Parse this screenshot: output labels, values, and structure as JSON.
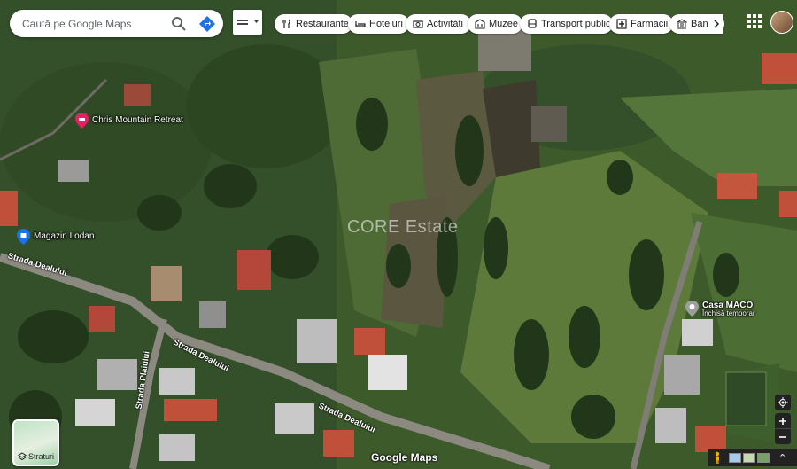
{
  "search": {
    "placeholder": "Caută pe Google Maps"
  },
  "chips": [
    {
      "label": "Restaurante",
      "icon": "fork-knife-icon"
    },
    {
      "label": "Hoteluri",
      "icon": "bed-icon"
    },
    {
      "label": "Activități",
      "icon": "camera-icon"
    },
    {
      "label": "Muzee",
      "icon": "museum-icon"
    },
    {
      "label": "Transport public",
      "icon": "bus-icon"
    },
    {
      "label": "Farmacii",
      "icon": "pharmacy-icon"
    },
    {
      "label": "Banco",
      "icon": "bank-icon"
    }
  ],
  "places": {
    "retreat": {
      "name": "Chris Mountain Retreat",
      "icon": "hotel-pin-icon",
      "color": "#e91e63"
    },
    "shop": {
      "name": "Magazin Lodan",
      "icon": "shopping-pin-icon",
      "color": "#1a73e8"
    },
    "casa": {
      "name": "Casa MACO",
      "status": "Închisă temporar",
      "icon": "place-pin-icon",
      "color": "#9e9e9e"
    }
  },
  "streets": {
    "s1": "Strada Dealului",
    "s2": "Strada Dealului",
    "s3": "Strada Dealului",
    "s4": "Strada Plaiului"
  },
  "watermark": "CORE Estate",
  "layers_label": "Straturi",
  "logo": "Google Maps"
}
